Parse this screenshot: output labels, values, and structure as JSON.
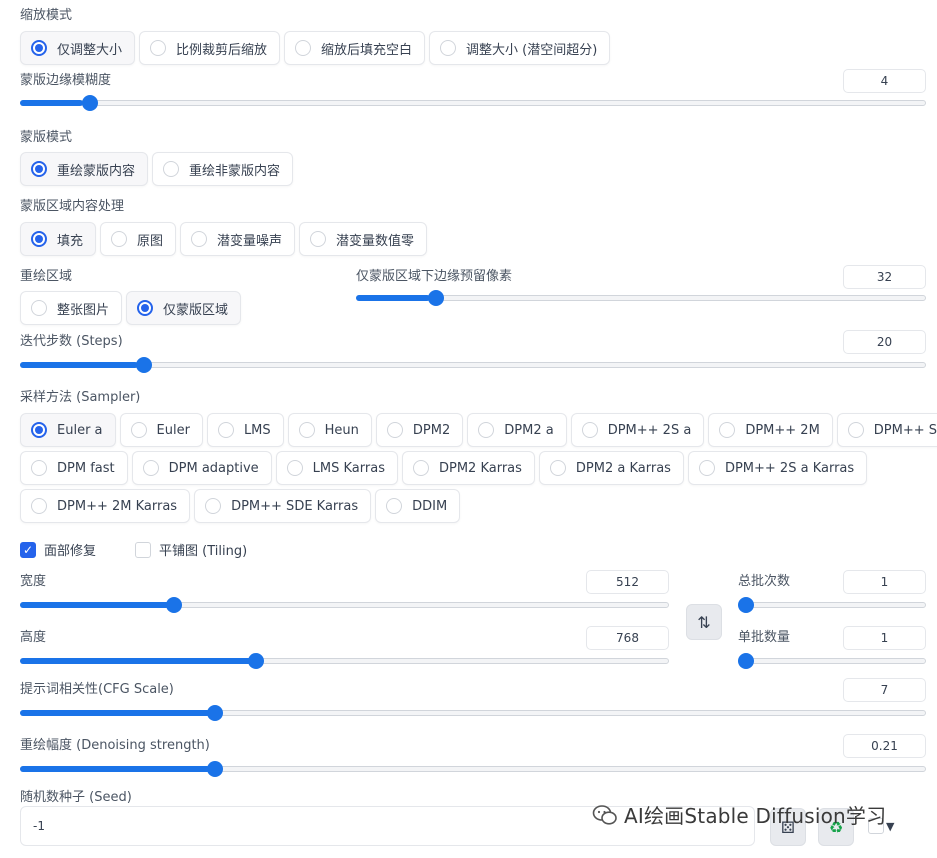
{
  "resize_mode": {
    "label": "缩放模式",
    "options": [
      "仅调整大小",
      "比例裁剪后缩放",
      "缩放后填充空白",
      "调整大小 (潜空间超分)"
    ],
    "selected": 0
  },
  "mask_blur": {
    "label": "蒙版边缘模糊度",
    "value": "4",
    "fraction": 0.07
  },
  "mask_mode": {
    "label": "蒙版模式",
    "options": [
      "重绘蒙版内容",
      "重绘非蒙版内容"
    ],
    "selected": 0
  },
  "masked_content": {
    "label": "蒙版区域内容处理",
    "options": [
      "填充",
      "原图",
      "潜变量噪声",
      "潜变量数值零"
    ],
    "selected": 0
  },
  "inpaint_area": {
    "label": "重绘区域",
    "options": [
      "整张图片",
      "仅蒙版区域"
    ],
    "selected": 1
  },
  "only_masked_padding": {
    "label": "仅蒙版区域下边缘预留像素",
    "value": "32",
    "fraction": 0.13
  },
  "steps": {
    "label": "迭代步数 (Steps)",
    "value": "20",
    "fraction": 0.13
  },
  "sampler": {
    "label": "采样方法 (Sampler)",
    "rows": [
      [
        "Euler a",
        "Euler",
        "LMS",
        "Heun",
        "DPM2",
        "DPM2 a",
        "DPM++ 2S a",
        "DPM++ 2M",
        "DPM++ SDE"
      ],
      [
        "DPM fast",
        "DPM adaptive",
        "LMS Karras",
        "DPM2 Karras",
        "DPM2 a Karras",
        "DPM++ 2S a Karras"
      ],
      [
        "DPM++ 2M Karras",
        "DPM++ SDE Karras",
        "DDIM"
      ]
    ],
    "selected": "Euler a"
  },
  "restore_faces": {
    "label": "面部修复",
    "checked": true
  },
  "tiling": {
    "label": "平铺图 (Tiling)",
    "checked": false
  },
  "width": {
    "label": "宽度",
    "value": "512",
    "fraction": 0.23
  },
  "height": {
    "label": "高度",
    "value": "768",
    "fraction": 0.36
  },
  "batch_count": {
    "label": "总批次数",
    "value": "1",
    "fraction": 0.0
  },
  "batch_size": {
    "label": "单批数量",
    "value": "1",
    "fraction": 0.0
  },
  "swap_icon": "swap-vertical-icon",
  "cfg_scale": {
    "label": "提示词相关性(CFG Scale)",
    "value": "7",
    "fraction": 0.21
  },
  "denoising": {
    "label": "重绘幅度 (Denoising strength)",
    "value": "0.21",
    "fraction": 0.21
  },
  "seed": {
    "label": "随机数种子 (Seed)",
    "value": "-1"
  },
  "seed_buttons": [
    "dice-icon",
    "recycle-icon"
  ],
  "watermark": {
    "text": "AI绘画Stable Diffusion学习"
  },
  "accent_color": "#1a73e8"
}
